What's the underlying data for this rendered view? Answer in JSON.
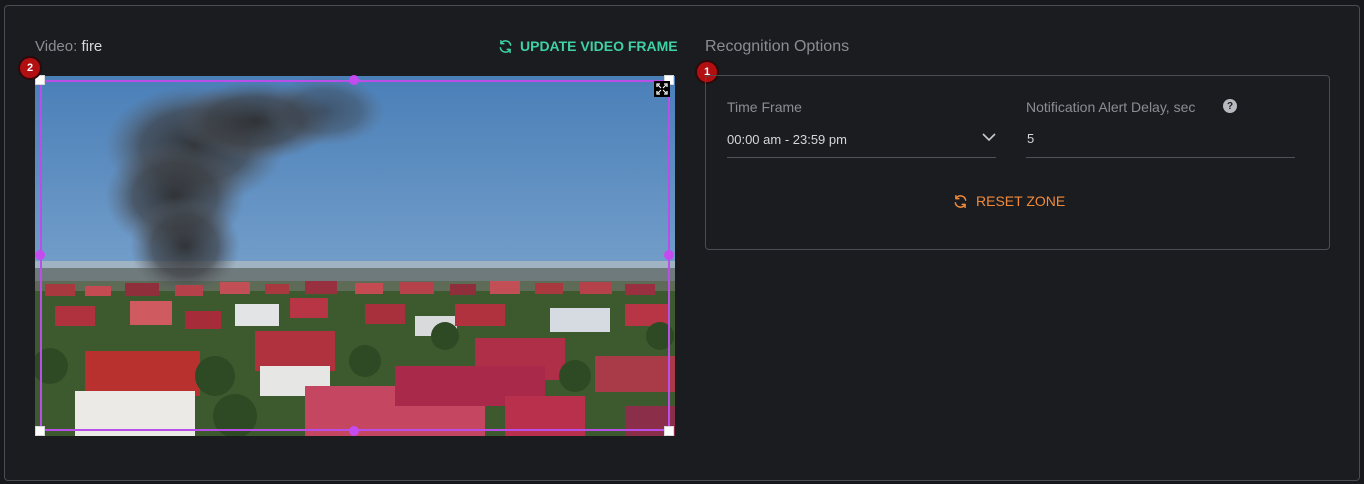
{
  "video": {
    "label": "Video:",
    "name": "fire",
    "update_label": "UPDATE VIDEO FRAME"
  },
  "recognition": {
    "title": "Recognition Options",
    "time_frame": {
      "label": "Time Frame",
      "value": "00:00 am - 23:59 pm"
    },
    "alert_delay": {
      "label": "Notification Alert Delay, sec",
      "value": "5",
      "help_icon": "question-circle-icon"
    },
    "reset_label": "RESET ZONE"
  },
  "badges": {
    "options": "1",
    "video": "2"
  },
  "colors": {
    "accent_green": "#3ed1a4",
    "accent_orange": "#f08a3b",
    "zone_purple": "#b94ee8",
    "badge_red": "#b20f12"
  }
}
